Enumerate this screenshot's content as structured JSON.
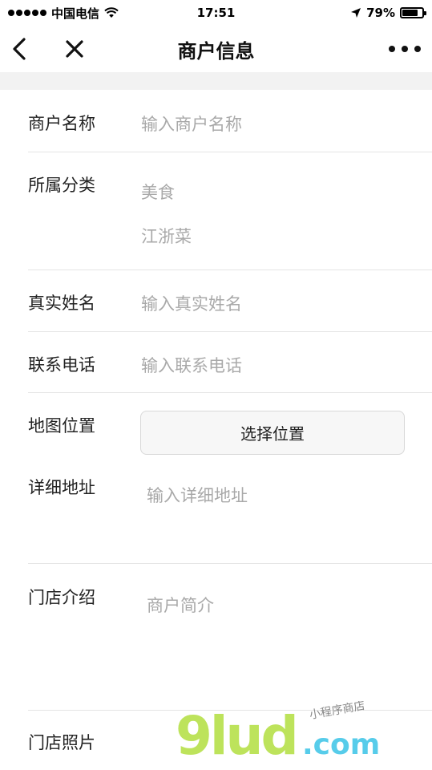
{
  "status_bar": {
    "carrier": "中国电信",
    "time": "17:51",
    "battery": "79%",
    "battery_level": 0.79
  },
  "nav": {
    "title": "商户信息",
    "back_icon": "chevron-left-icon",
    "close_icon": "close-icon",
    "more_icon": "more-horizontal-icon"
  },
  "form": {
    "merchant_name": {
      "label": "商户名称",
      "placeholder": "输入商户名称"
    },
    "category": {
      "label": "所属分类",
      "primary": "美食",
      "secondary": "江浙菜"
    },
    "real_name": {
      "label": "真实姓名",
      "placeholder": "输入真实姓名"
    },
    "phone": {
      "label": "联系电话",
      "placeholder": "输入联系电话"
    },
    "map_location": {
      "label": "地图位置",
      "button_label": "选择位置"
    },
    "address": {
      "label": "详细地址",
      "placeholder": "输入详细地址"
    },
    "intro": {
      "label": "门店介绍",
      "placeholder": "商户简介"
    },
    "photos": {
      "label": "门店照片"
    }
  },
  "watermark": {
    "logo": "9lud",
    "suffix": ".com",
    "tagline": "小程序商店"
  }
}
